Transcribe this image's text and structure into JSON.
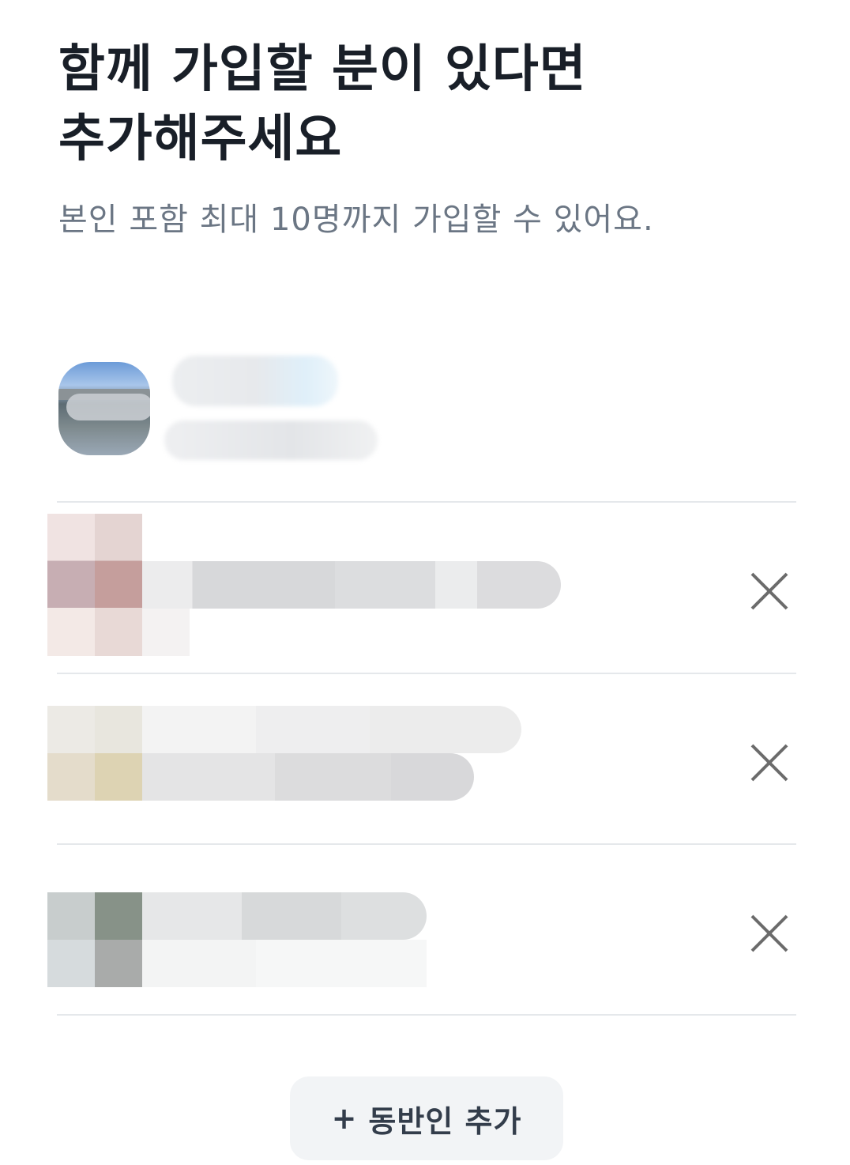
{
  "header": {
    "title_line1": "함께 가입할 분이 있다면",
    "title_line2": "추가해주세요",
    "subtitle": "본인 포함 최대 10명까지 가입할 수 있어요."
  },
  "companions": [
    {
      "remove_icon": "close-icon"
    },
    {
      "remove_icon": "close-icon"
    },
    {
      "remove_icon": "close-icon"
    }
  ],
  "add_button": {
    "plus": "+",
    "label": "동반인 추가"
  },
  "colors": {
    "title": "#191f28",
    "subtitle": "#6b7684",
    "divider": "#e5e8eb",
    "button_bg": "#f2f4f6",
    "button_text": "#333d4b",
    "close_icon": "#6b6b6b"
  }
}
